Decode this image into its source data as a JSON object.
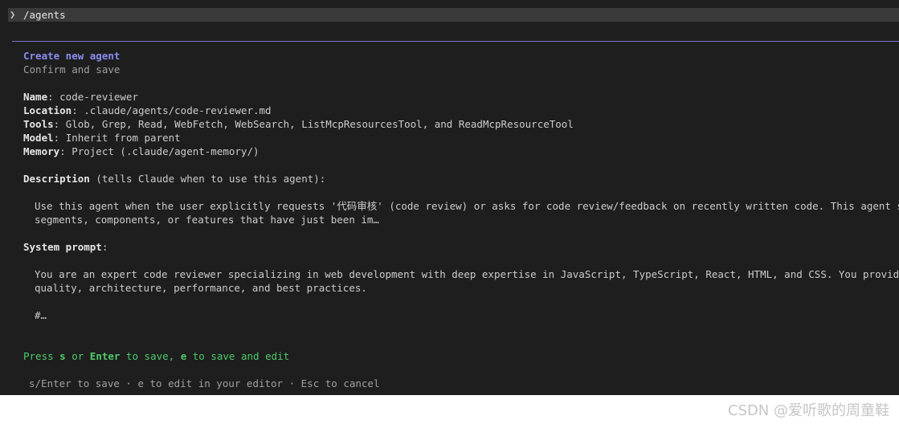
{
  "command": {
    "text": "/agents"
  },
  "panel": {
    "title": "Create new agent",
    "subtitle": "Confirm and save"
  },
  "fields": {
    "name_label": "Name",
    "name_value": ": code-reviewer",
    "location_label": "Location",
    "location_value": ": .claude/agents/code-reviewer.md",
    "tools_label": "Tools",
    "tools_value": ": Glob, Grep, Read, WebFetch, WebSearch, ListMcpResourcesTool, and ReadMcpResourceTool",
    "model_label": "Model",
    "model_value": ": Inherit from parent",
    "memory_label": "Memory",
    "memory_value": ": Project (.claude/agent-memory/)"
  },
  "description": {
    "label": "Description",
    "hint": " (tells Claude when to use this agent):",
    "line1": "Use this agent when the user explicitly requests '代码审核' (code review) or asks for code review/feedback on recently written code. This agent should be",
    "line2": "segments, components, or features that have just been im…"
  },
  "system_prompt": {
    "label": "System prompt",
    "colon": ":",
    "line1": "You are an expert code reviewer specializing in web development with deep expertise in JavaScript, TypeScript, React, HTML, and CSS. You provide thorough,",
    "line2": "quality, architecture, performance, and best practices.",
    "line3": "#…"
  },
  "save_prompt": {
    "t1": "Press ",
    "k1": "s",
    "t2": " or ",
    "k2": "Enter",
    "t3": " to save, ",
    "k3": "e",
    "t4": " to save and edit"
  },
  "footer": {
    "hint": "s/Enter to save · e to edit in your editor · Esc to cancel"
  },
  "watermark": "CSDN @爱听歌的周童鞋",
  "colors": {
    "background": "#1e1e1e",
    "title": "#8a8cf0",
    "success": "#4ec96b",
    "divider": "#7a78c8"
  }
}
